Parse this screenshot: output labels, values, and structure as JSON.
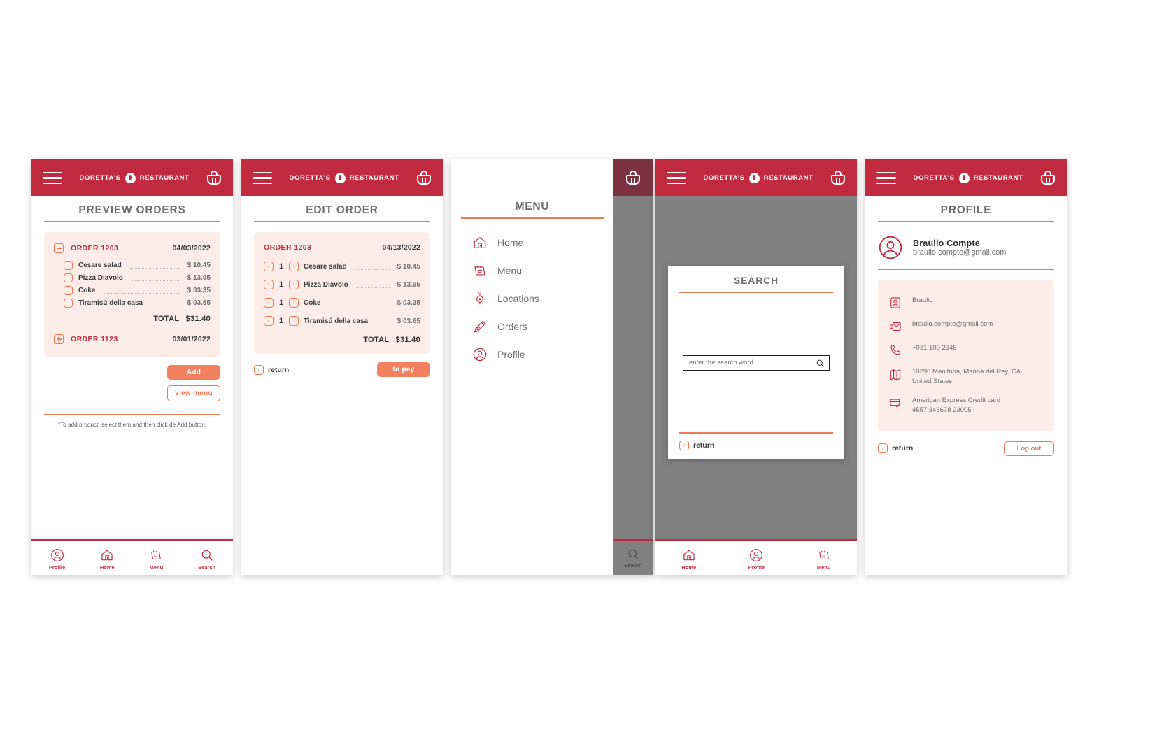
{
  "brand": {
    "name_left": "DORETTA'S",
    "name_right": "RESTAURANT",
    "logo": "flame-icon"
  },
  "screens": {
    "preview_orders": {
      "title": "PREVIEW ORDERS",
      "orders": [
        {
          "id": "ORDER 1203",
          "date": "04/03/2022",
          "expanded": true,
          "toggle": "minus",
          "items": [
            {
              "name": "Cesare salad",
              "price": "$ 10.45"
            },
            {
              "name": "Pizza Diavolo",
              "price": "$ 13.95"
            },
            {
              "name": "Coke",
              "price": "$ 03.35"
            },
            {
              "name": "Tiramisú della casa",
              "price": "$ 03.65"
            }
          ],
          "total_label": "TOTAL",
          "total_value": "$31.40"
        },
        {
          "id": "ORDER 1123",
          "date": "03/01/2022",
          "expanded": false,
          "toggle": "plus",
          "items": [],
          "total_label": "",
          "total_value": ""
        }
      ],
      "add_label": "Add",
      "view_menu_label": "view menu",
      "footnote": "*To add product, select them and then click de Add button.",
      "nav": [
        {
          "label": "Profile",
          "icon": "profile-icon"
        },
        {
          "label": "Home",
          "icon": "home-icon"
        },
        {
          "label": "Menu",
          "icon": "menu-notebook-icon"
        },
        {
          "label": "Search",
          "icon": "search-icon"
        }
      ]
    },
    "edit_order": {
      "title": "EDIT ORDER",
      "order_id": "ORDER 1203",
      "order_date": "04/13/2022",
      "items": [
        {
          "qty": "1",
          "name": "Cesare salad",
          "price": "$ 10.45"
        },
        {
          "qty": "1",
          "name": "Pizza Diavolo",
          "price": "$ 13.95"
        },
        {
          "qty": "1",
          "name": "Coke",
          "price": "$ 03.35"
        },
        {
          "qty": "1",
          "name": "Tiramisú della casa",
          "price": "$ 03.65"
        }
      ],
      "total_label": "TOTAL",
      "total_value": "$31.40",
      "return_label": "return",
      "to_pay_label": "to pay"
    },
    "menu_drawer": {
      "title": "MENU",
      "items": [
        {
          "label": "Home",
          "icon": "home-icon"
        },
        {
          "label": "Menu",
          "icon": "menu-notebook-icon"
        },
        {
          "label": "Locations",
          "icon": "compass-icon"
        },
        {
          "label": "Orders",
          "icon": "pencil-orders-icon"
        },
        {
          "label": "Profile",
          "icon": "profile-icon"
        }
      ],
      "dim_nav_label": "Search"
    },
    "search": {
      "title": "SEARCH",
      "input_placeholder": "enter the search word",
      "input_value": "",
      "return_label": "return",
      "nav": [
        {
          "label": "Home",
          "icon": "home-icon"
        },
        {
          "label": "Profile",
          "icon": "profile-icon"
        },
        {
          "label": "Menu",
          "icon": "menu-notebook-icon"
        }
      ]
    },
    "profile": {
      "title": "PROFILE",
      "user_name": "Braulio Compte",
      "user_email": "braulio.compte@gmail.com",
      "details": [
        {
          "icon": "user-card-icon",
          "text": "Braulio"
        },
        {
          "icon": "mail-icon",
          "text": "braulio.compte@gmail.com"
        },
        {
          "icon": "phone-icon",
          "text": "+031 100 2345"
        },
        {
          "icon": "map-icon",
          "text": "10290 Manitoba, Marina del Rey, CA\nUnited States"
        },
        {
          "icon": "credit-card-icon",
          "text": "American Express Credit card\n4557 345678 23005"
        }
      ],
      "return_label": "return",
      "logout_label": "Log out"
    }
  },
  "colors": {
    "brand_red": "#C22A40",
    "accent_orange": "#ED7A54",
    "button_orange": "#F08060",
    "card_pink": "#FCEDE8",
    "overlay_gray": "#808080",
    "text_gray": "#6E6E6E"
  }
}
